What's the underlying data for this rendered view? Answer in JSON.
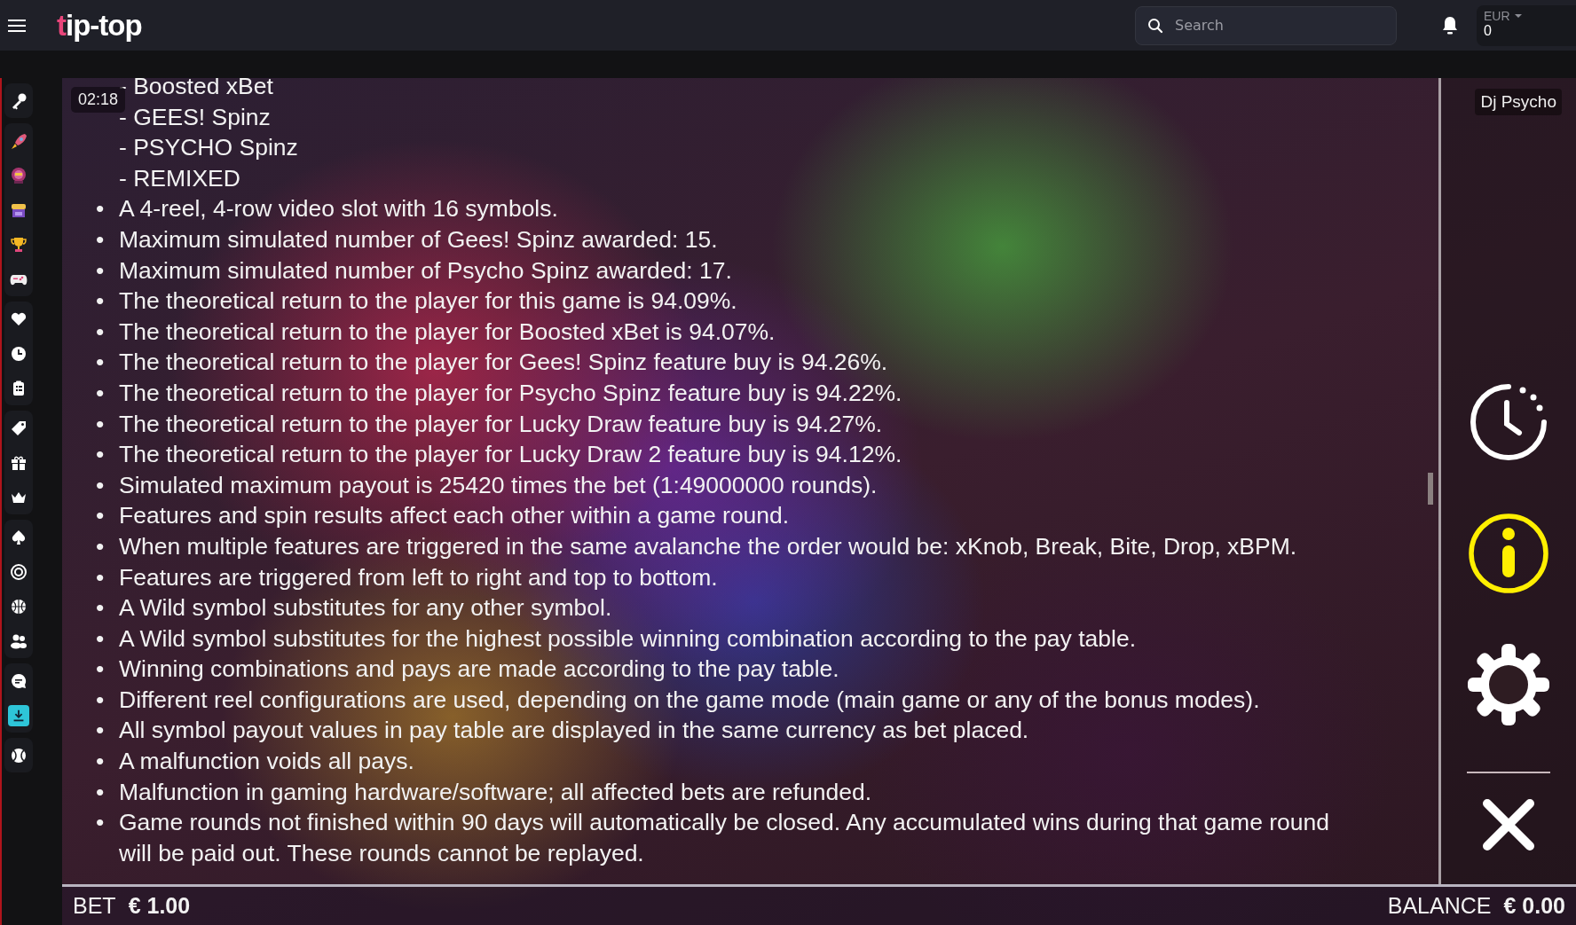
{
  "header": {
    "logo": "tip-top",
    "search": {
      "placeholder": "Search"
    },
    "currency": "EUR",
    "balance": "0"
  },
  "game": {
    "timer": "02:18",
    "title": "Dj Psycho",
    "sub_items": [
      "- Boosted xBet",
      "- GEES! Spinz",
      "- PSYCHO Spinz",
      "- REMIXED"
    ],
    "rules": [
      {
        "bullet": "•",
        "text": "A 4-reel, 4-row video slot with 16 symbols."
      },
      {
        "bullet": "•",
        "text": "Maximum simulated number of Gees! Spinz awarded: 15."
      },
      {
        "bullet": "•",
        "text": "Maximum simulated number of Psycho Spinz awarded: 17."
      },
      {
        "bullet": "•",
        "text": "The theoretical return to the player for this game is 94.09%."
      },
      {
        "bullet": "•",
        "text": "The theoretical return to the player for Boosted xBet is 94.07%."
      },
      {
        "bullet": "•",
        "text": "The theoretical return to the player for Gees! Spinz feature buy is 94.26%."
      },
      {
        "bullet": "•",
        "text": "The theoretical return to the player for Psycho Spinz feature buy is 94.22%."
      },
      {
        "bullet": "•",
        "text": "The theoretical return to the player for Lucky Draw feature buy is 94.27%."
      },
      {
        "bullet": "•",
        "text": "The theoretical return to the player for Lucky Draw 2 feature buy is 94.12%."
      },
      {
        "bullet": "•",
        "text": "Simulated maximum payout is 25420 times the bet (1:49000000 rounds)."
      },
      {
        "bullet": "•",
        "text": "Features and spin results affect each other within a game round."
      },
      {
        "bullet": "•",
        "text": "When multiple features are triggered in the same avalanche the order would be: xKnob, Break, Bite, Drop, xBPM."
      },
      {
        "bullet": "•",
        "text": "Features are triggered from left to right and top to bottom."
      },
      {
        "bullet": "•",
        "text": "A Wild symbol substitutes for any other symbol."
      },
      {
        "bullet": "•",
        "text": "A Wild symbol substitutes for the highest possible winning combination according to the pay table."
      },
      {
        "bullet": "•",
        "text": "Winning combinations and pays are made according to the pay table."
      },
      {
        "bullet": "•",
        "text": "Different reel configurations are used, depending on the game mode (main game or any of the bonus modes)."
      },
      {
        "bullet": "•",
        "text": "All symbol payout values in pay table are displayed in the same currency as bet placed."
      },
      {
        "bullet": "•",
        "text": "A malfunction voids all pays."
      },
      {
        "bullet": "•",
        "text": "Malfunction in gaming hardware/software; all affected bets are refunded."
      },
      {
        "bullet": "•",
        "text": "Game rounds not finished within 90 days will automatically be closed. Any accumulated wins during that game round will be paid out. These rounds cannot be replayed."
      }
    ],
    "bet_label": "BET",
    "bet": "€ 1.00",
    "balance_label": "BALANCE",
    "balance": "€ 0.00"
  }
}
